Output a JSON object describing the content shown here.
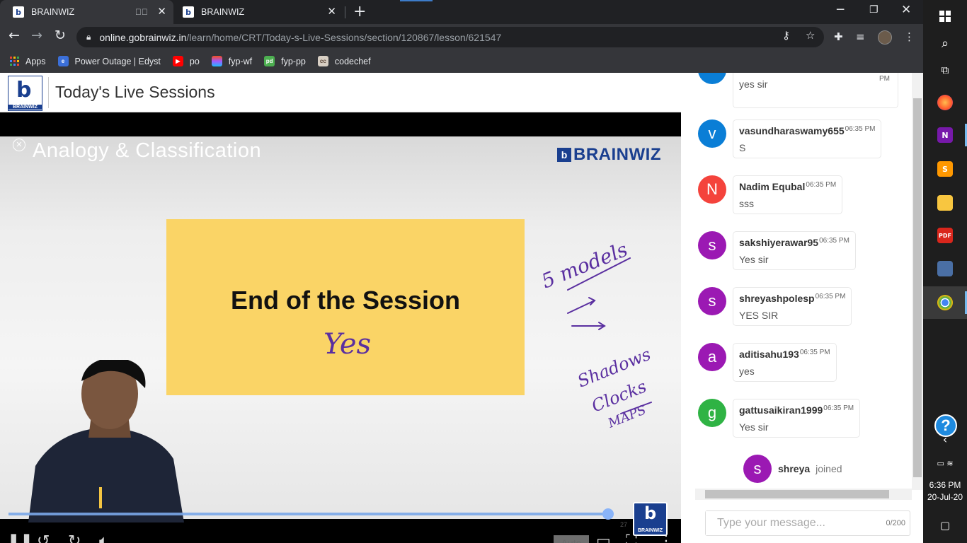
{
  "tabs": [
    {
      "title": "BRAINWIZ",
      "active": true,
      "muted": true
    },
    {
      "title": "BRAINWIZ",
      "active": false
    }
  ],
  "address": {
    "host": "online.gobrainwiz.in",
    "path": "/learn/home/CRT/Today-s-Live-Sessions/section/120867/lesson/621547"
  },
  "bookmarks": [
    {
      "label": "Apps",
      "icon": "apps-grid-icon"
    },
    {
      "label": "Power Outage | Edyst",
      "icon": "edyst-icon",
      "color": "#3b6fd8"
    },
    {
      "label": "po",
      "icon": "youtube-icon",
      "color": "#ff0000"
    },
    {
      "label": "fyp-wf",
      "icon": "figma-icon",
      "color": "#a259ff"
    },
    {
      "label": "fyp-pp",
      "icon": "pdf-icon",
      "color": "#4caf50"
    },
    {
      "label": "codechef",
      "icon": "codechef-icon",
      "color": "#5b4638"
    }
  ],
  "page": {
    "title": "Today's Live Sessions",
    "logo_letter": "b",
    "logo_text": "BRAINWIZ"
  },
  "video": {
    "slide_title": "Analogy & Classification",
    "brand": "BRAINWIZ",
    "card_text": "End of the Session",
    "handwritten": {
      "card_note": "Yes",
      "side_1": "5 models",
      "side_2": "Shadows",
      "side_3": "Clocks",
      "side_4": "MAPS"
    },
    "time_marker": "27",
    "quality": "Auto",
    "progress": 0.99
  },
  "chat": {
    "messages": [
      {
        "initial": "",
        "name": "",
        "time": "PM",
        "text": "yes sir",
        "color": "#0a7ed6"
      },
      {
        "initial": "v",
        "name": "vasundharaswamy655",
        "time": "06:35 PM",
        "text": "S",
        "color": "#0a7ed6"
      },
      {
        "initial": "N",
        "name": "Nadim Equbal",
        "time": "06:35 PM",
        "text": "sss",
        "color": "#f4433c"
      },
      {
        "initial": "s",
        "name": "sakshiyerawar95",
        "time": "06:35 PM",
        "text": "Yes sir",
        "color": "#9b19b3"
      },
      {
        "initial": "s",
        "name": "shreyashpolesp",
        "time": "06:35 PM",
        "text": "YES SIR",
        "color": "#9b19b3"
      },
      {
        "initial": "a",
        "name": "aditisahu193",
        "time": "06:35 PM",
        "text": "yes",
        "color": "#9b19b3"
      },
      {
        "initial": "g",
        "name": "gattusaikiran1999",
        "time": "06:35 PM",
        "text": "Yes sir",
        "color": "#2fb344"
      }
    ],
    "joined": {
      "initial": "s",
      "name": "shreya",
      "word": "joined",
      "color": "#9b19b3"
    },
    "input_placeholder": "Type your message...",
    "counter": "0/200"
  },
  "taskbar": {
    "time": "6:36 PM",
    "date": "20-Jul-20",
    "help": "?"
  }
}
